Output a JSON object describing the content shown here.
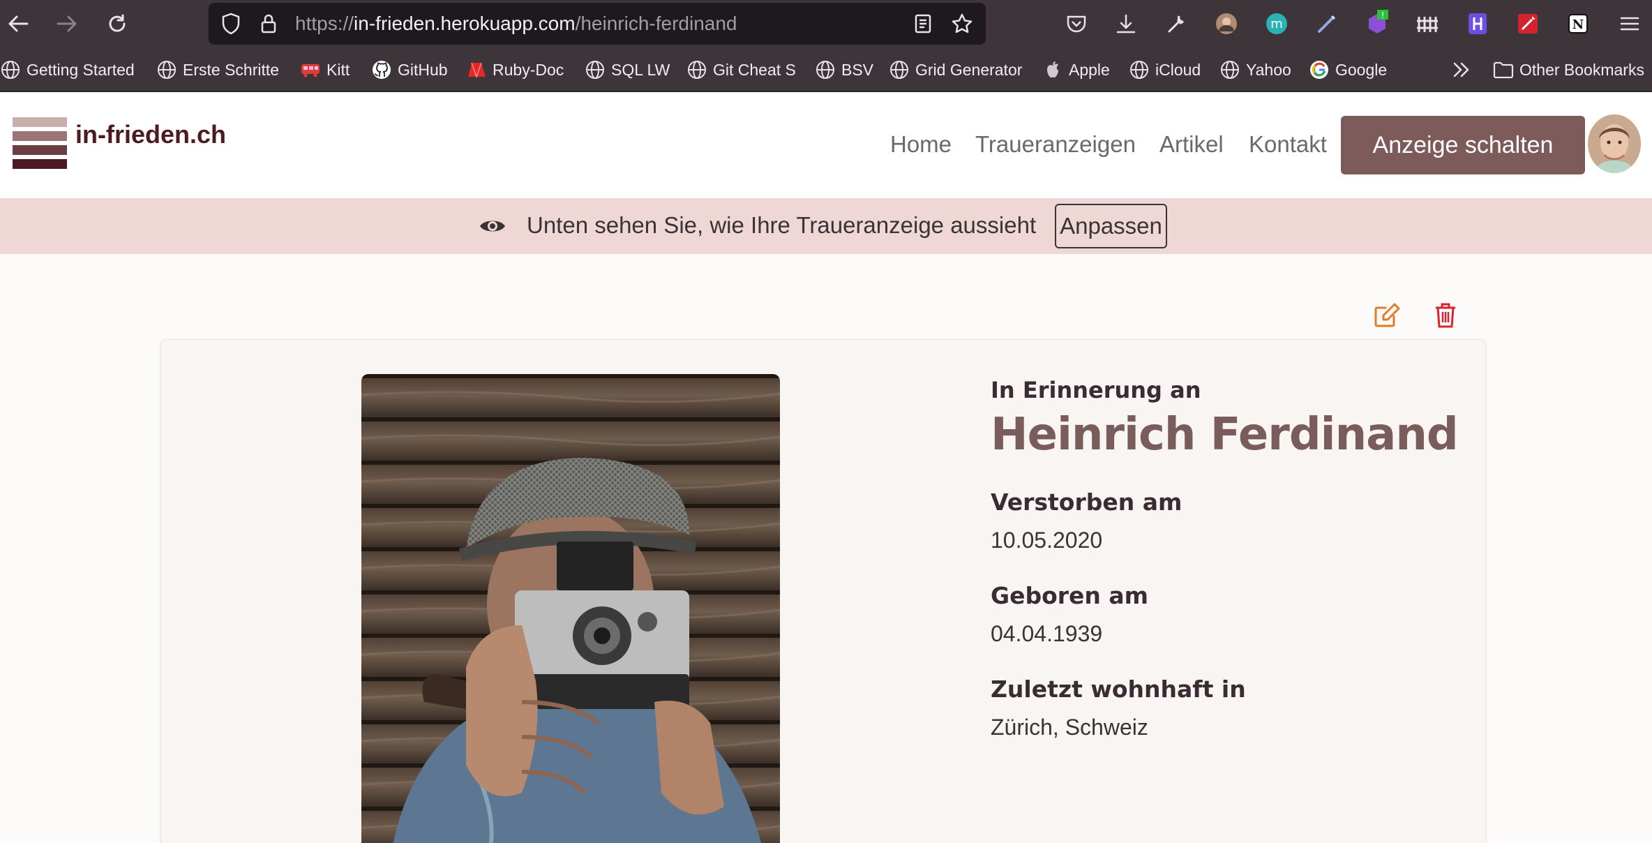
{
  "browser": {
    "url_prefix": "https://",
    "url_host": "in-frieden.herokuapp.com",
    "url_path": "/heinrich-ferdinand"
  },
  "bookmarks": [
    {
      "label": "Getting Started",
      "icon": "globe-icon"
    },
    {
      "label": "Erste Schritte",
      "icon": "globe-icon"
    },
    {
      "label": "Kitt",
      "icon": "bus-icon"
    },
    {
      "label": "GitHub",
      "icon": "github-icon"
    },
    {
      "label": "Ruby-Doc",
      "icon": "ruby-icon"
    },
    {
      "label": "SQL LW",
      "icon": "globe-icon"
    },
    {
      "label": "Git Cheat S",
      "icon": "globe-icon"
    },
    {
      "label": "BSV",
      "icon": "globe-icon"
    },
    {
      "label": "Grid Generator",
      "icon": "globe-icon"
    },
    {
      "label": "Apple",
      "icon": "apple-icon"
    },
    {
      "label": "iCloud",
      "icon": "globe-icon"
    },
    {
      "label": "Yahoo",
      "icon": "globe-icon"
    },
    {
      "label": "Google",
      "icon": "google-icon"
    }
  ],
  "other_bookmarks": "Other Bookmarks",
  "extension_badge": "!",
  "site": {
    "brand": "in-frieden.ch",
    "nav": [
      "Home",
      "Traueranzeigen",
      "Artikel",
      "Kontakt"
    ],
    "cta": "Anzeige schalten"
  },
  "banner": {
    "message": "Unten sehen Sie, wie Ihre Traueranzeige aussieht",
    "button": "Anpassen"
  },
  "obituary": {
    "intro": "In Erinnerung an",
    "name": "Heinrich Ferdinand",
    "died_label": "Verstorben am",
    "died_value": "10.05.2020",
    "born_label": "Geboren am",
    "born_value": "04.04.1939",
    "residence_label": "Zuletzt wohnhaft in",
    "residence_value": "Zürich, Schweiz"
  },
  "colors": {
    "accent": "#7d5b5b",
    "banner": "#efd7d5",
    "brand_text": "#4b1a22",
    "edit_icon": "#e07b27",
    "delete_icon": "#d9232e"
  }
}
